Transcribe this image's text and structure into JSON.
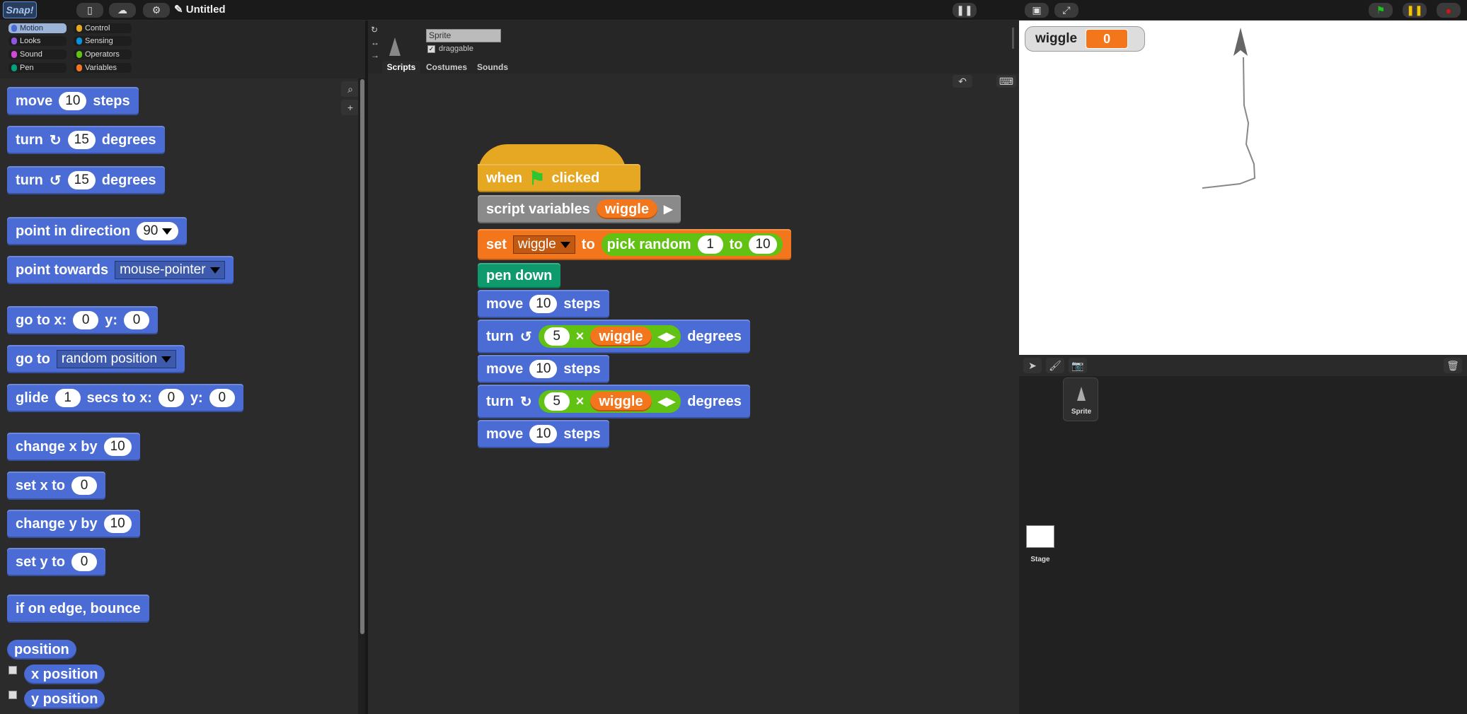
{
  "app": {
    "logo": "Snap!",
    "project_title": "Untitled"
  },
  "categories": [
    {
      "label": "Motion",
      "color": "#4a6cd4",
      "selected": true
    },
    {
      "label": "Control",
      "color": "#e6a822"
    },
    {
      "label": "Looks",
      "color": "#8f56e3"
    },
    {
      "label": "Sensing",
      "color": "#0494dc"
    },
    {
      "label": "Sound",
      "color": "#cf4ad9"
    },
    {
      "label": "Operators",
      "color": "#62c213"
    },
    {
      "label": "Pen",
      "color": "#00a178"
    },
    {
      "label": "Variables",
      "color": "#f3761d"
    }
  ],
  "palette": {
    "move": {
      "a": "move",
      "n": "10",
      "b": "steps"
    },
    "turn_cw": {
      "a": "turn",
      "n": "15",
      "b": "degrees"
    },
    "turn_ccw": {
      "a": "turn",
      "n": "15",
      "b": "degrees"
    },
    "point_dir": {
      "a": "point in direction",
      "n": "90"
    },
    "point_towards": {
      "a": "point towards",
      "v": "mouse-pointer"
    },
    "goto_xy": {
      "a": "go to x:",
      "x": "0",
      "b": "y:",
      "y": "0"
    },
    "goto": {
      "a": "go to",
      "v": "random position"
    },
    "glide": {
      "a": "glide",
      "s": "1",
      "b": "secs to x:",
      "x": "0",
      "c": "y:",
      "y": "0"
    },
    "change_x": {
      "a": "change x by",
      "n": "10"
    },
    "set_x": {
      "a": "set x to",
      "n": "0"
    },
    "change_y": {
      "a": "change y by",
      "n": "10"
    },
    "set_y": {
      "a": "set y to",
      "n": "0"
    },
    "bounce": {
      "a": "if on edge, bounce"
    },
    "position": "position",
    "x_position": "x position",
    "y_position": "y position"
  },
  "sprite": {
    "name": "Sprite",
    "draggable_label": "draggable"
  },
  "tabs": [
    "Scripts",
    "Costumes",
    "Sounds"
  ],
  "script": {
    "hat": {
      "a": "when",
      "b": "clicked"
    },
    "script_vars": {
      "a": "script variables",
      "v": "wiggle"
    },
    "set": {
      "a": "set",
      "var": "wiggle",
      "b": "to",
      "c": "pick random",
      "lo": "1",
      "d": "to",
      "hi": "10"
    },
    "pen": "pen down",
    "move1": {
      "a": "move",
      "n": "10",
      "b": "steps"
    },
    "turn1": {
      "a": "turn",
      "n": "5",
      "op": "×",
      "v": "wiggle",
      "b": "degrees"
    },
    "move2": {
      "a": "move",
      "n": "10",
      "b": "steps"
    },
    "turn2": {
      "a": "turn",
      "n": "5",
      "op": "×",
      "v": "wiggle",
      "b": "degrees"
    },
    "move3": {
      "a": "move",
      "n": "10",
      "b": "steps"
    }
  },
  "watcher": {
    "name": "wiggle",
    "value": "0"
  },
  "corral": {
    "sprite_label": "Sprite",
    "stage_label": "Stage"
  }
}
